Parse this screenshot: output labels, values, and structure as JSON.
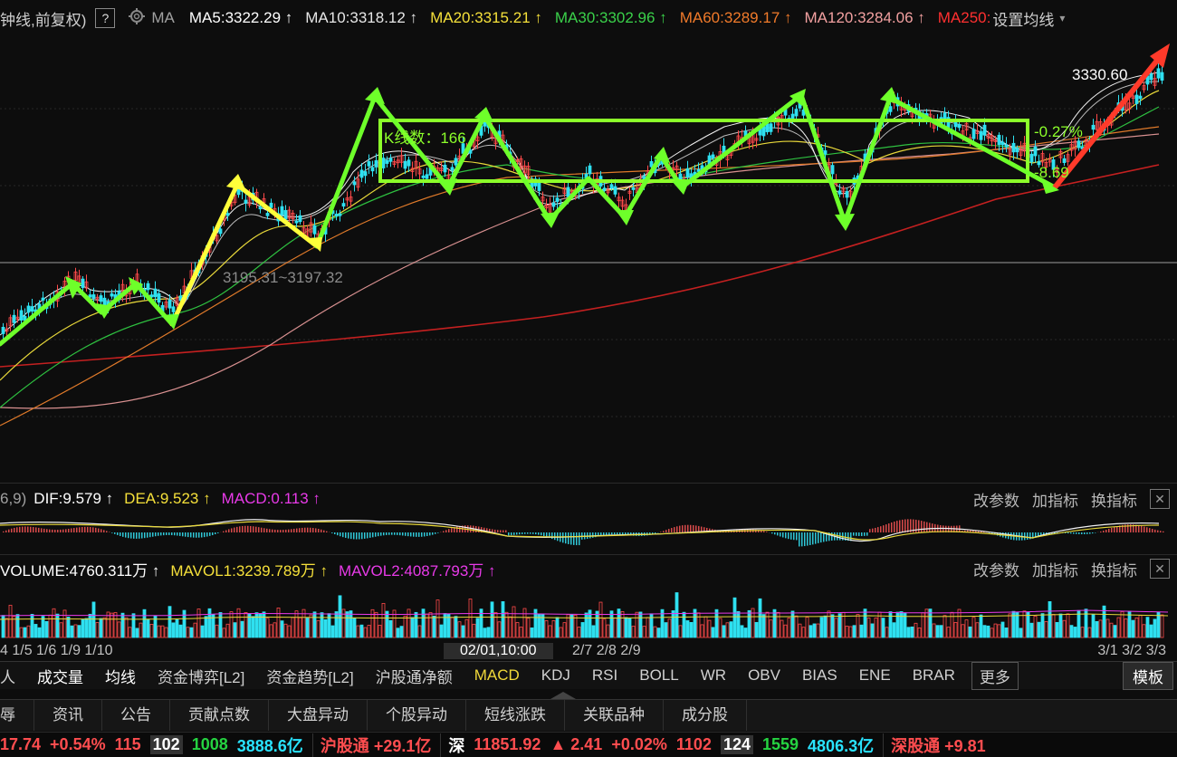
{
  "ma_bar": {
    "title": "钟线,前复权)",
    "help": "?",
    "ma_label": "MA",
    "items": [
      {
        "text": "MA5:3322.29 ↑",
        "color": "#ffffff"
      },
      {
        "text": "MA10:3318.12 ↑",
        "color": "#e6e6e6"
      },
      {
        "text": "MA20:3315.21 ↑",
        "color": "#f5e03a"
      },
      {
        "text": "MA30:3302.96 ↑",
        "color": "#3ad04a"
      },
      {
        "text": "MA60:3289.17 ↑",
        "color": "#f07a2a"
      },
      {
        "text": "MA120:3284.06 ↑",
        "color": "#f2a0a0"
      },
      {
        "text": "MA250:",
        "color": "#ff3030"
      }
    ],
    "set_ma": "设置均线",
    "set_ma_arrow": "▾"
  },
  "chart": {
    "high_label": "3330.60",
    "low_label": "3195.31~3197.32",
    "box_label": "K线数：166",
    "pct_up": "-0.27%",
    "pct_down": "-8.69"
  },
  "macd": {
    "prefix": "6,9)",
    "dif": "DIF:9.579 ↑",
    "dea": "DEA:9.523 ↑",
    "macd": "MACD:0.113 ↑",
    "actions": [
      "改参数",
      "加指标",
      "换指标"
    ],
    "close": "✕"
  },
  "volume": {
    "vol": "VOLUME:4760.311万 ↑",
    "mavol1": "MAVOL1:3239.789万 ↑",
    "mavol2": "MAVOL2:4087.793万 ↑",
    "actions": [
      "改参数",
      "加指标",
      "换指标"
    ],
    "close": "✕"
  },
  "date_axis": {
    "left": "4 1/5 1/6 1/9 1/10",
    "center": "02/01,10:00",
    "mid": "2/7 2/8 2/9",
    "right": "3/1 3/2 3/3"
  },
  "tabs": {
    "items": [
      "人",
      "成交量",
      "均线",
      "资金博弈[L2]",
      "资金趋势[L2]",
      "沪股通净额",
      "MACD",
      "KDJ",
      "RSI",
      "BOLL",
      "WR",
      "OBV",
      "BIAS",
      "ENE",
      "BRAR"
    ],
    "more": "更多",
    "template": "模板"
  },
  "subtabs": [
    "辱",
    "资讯",
    "公告",
    "贡献点数",
    "大盘异动",
    "个股异动",
    "短线涨跌",
    "关联品种",
    "成分股"
  ],
  "ticker": {
    "a": "17.74",
    "b": "+0.54%",
    "c": "115",
    "d": "102",
    "e": "1008",
    "f": "3888.6亿",
    "g": "沪股通 +29.1亿",
    "h": "深",
    "i": "11851.92",
    "j": "▲ 2.41",
    "k": "+0.02%",
    "l": "1102",
    "m": "124",
    "n": "1559",
    "o": "4806.3亿",
    "p": "深股通 +9.81"
  },
  "colors": {
    "accent_green": "#7cff2a",
    "accent_yellow": "#ffff3a",
    "accent_red": "#ff3a2a",
    "bg": "#0d0d0d"
  }
}
